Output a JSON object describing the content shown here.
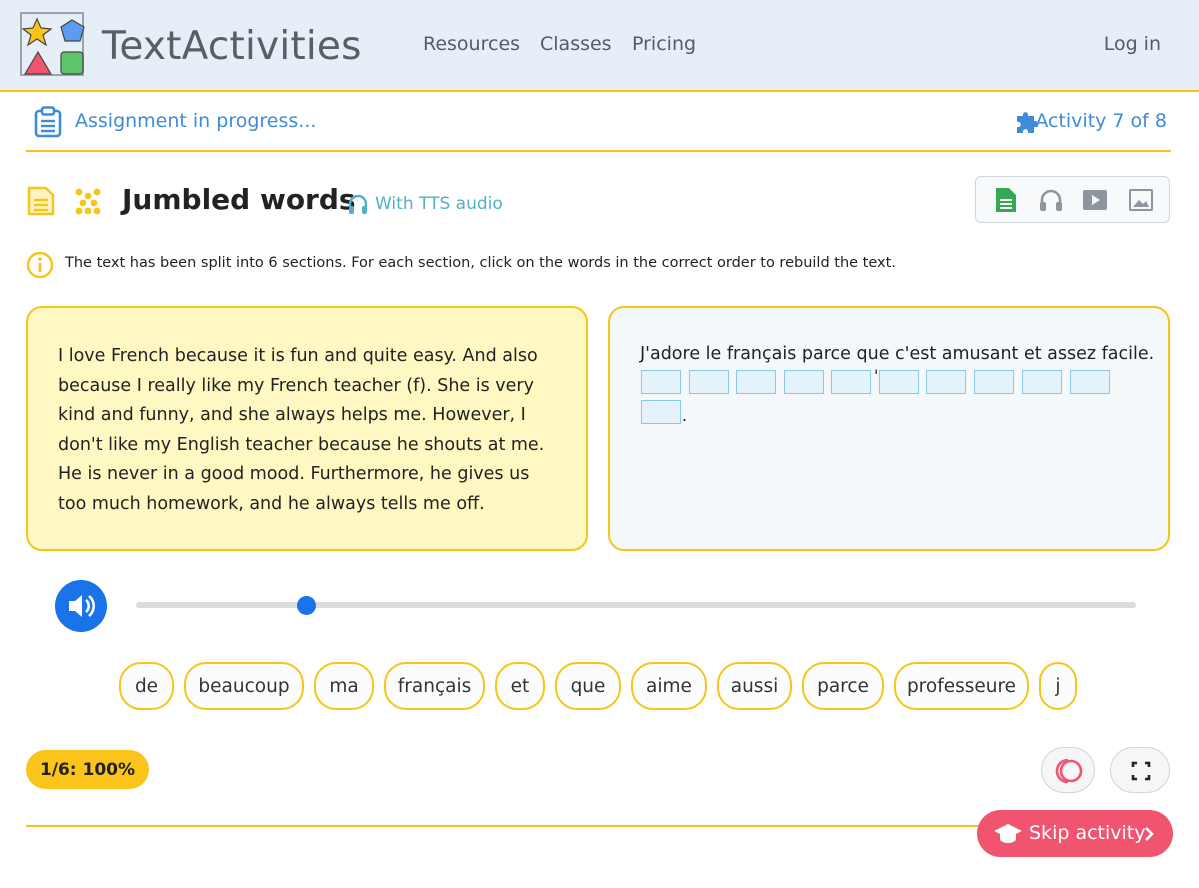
{
  "header": {
    "brand": "TextActivities",
    "nav": [
      "Resources",
      "Classes",
      "Pricing"
    ],
    "login": "Log in"
  },
  "status": {
    "assignment": "Assignment in progress...",
    "activity": "Activity 7 of 8"
  },
  "activity": {
    "title": "Jumbled words",
    "tts_label": "With TTS audio",
    "instructions": "The text has been split into 6 sections. For each section, click on the words in the correct order to rebuild the text.",
    "modes": [
      "document-icon",
      "headphones-icon",
      "video-icon",
      "image-icon"
    ]
  },
  "english_text": "I love French because it is fun and quite easy. And also because I really like my French teacher (f). She is very kind and funny, and she always helps me. However, I don't like my English teacher because he shouts at me. He is never in a good mood. Furthermore, he gives us too much homework, and he always tells me off.",
  "french_text": "J'adore le français parce que c'est amusant et assez facile.",
  "answer_slots": 11,
  "audio": {
    "progress": 0.17
  },
  "words": [
    "de",
    "beaucoup",
    "ma",
    "français",
    "et",
    "que",
    "aime",
    "aussi",
    "parce",
    "professeure",
    "j"
  ],
  "score": "1/6: 100%",
  "skip_label": "Skip activity",
  "colors": {
    "accent_yellow": "#f5c518",
    "link_blue": "#3d8bd9",
    "skip_pink": "#f0546e",
    "audio_blue": "#1a73e8"
  }
}
